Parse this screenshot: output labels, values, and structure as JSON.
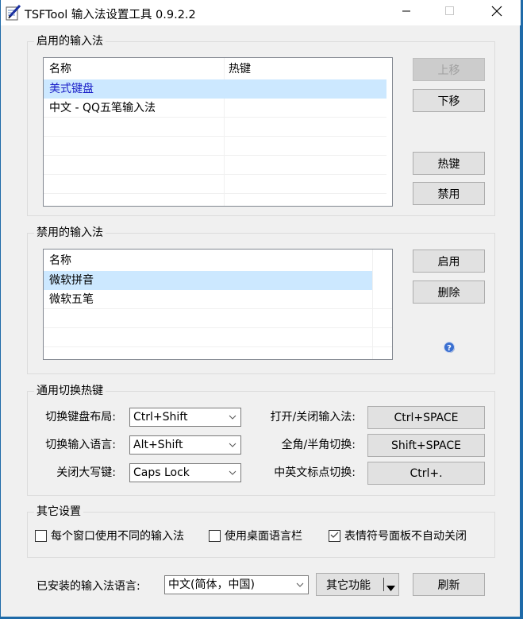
{
  "window": {
    "title": "TSFTool 输入法设置工具 0.9.2.2",
    "controls": {
      "minimize": "minimize-icon",
      "maximize": "maximize-icon",
      "close": "close-icon"
    }
  },
  "enabled_group": {
    "title": "启用的输入法",
    "columns": [
      "名称",
      "热键"
    ],
    "rows": [
      {
        "name": "美式键盘",
        "hotkey": "",
        "selected": true
      },
      {
        "name": "中文 - QQ五笔输入法",
        "hotkey": "",
        "selected": false
      }
    ],
    "buttons": {
      "move_up": "上移",
      "move_down": "下移",
      "hotkey": "热键",
      "disable": "禁用"
    }
  },
  "disabled_group": {
    "title": "禁用的输入法",
    "columns": [
      "名称"
    ],
    "rows": [
      {
        "name": "微软拼音",
        "selected": true
      },
      {
        "name": "微软五笔",
        "selected": false
      }
    ],
    "buttons": {
      "enable": "启用",
      "delete": "删除"
    },
    "help_icon": "help-icon"
  },
  "hotkeys_group": {
    "title": "通用切换热键",
    "switch_layout_label": "切换键盘布局:",
    "switch_layout_value": "Ctrl+Shift",
    "switch_language_label": "切换输入语言:",
    "switch_language_value": "Alt+Shift",
    "caps_off_label": "关闭大写键:",
    "caps_off_value": "Caps Lock",
    "toggle_ime_label": "打开/关闭输入法:",
    "toggle_ime_value": "Ctrl+SPACE",
    "full_half_label": "全角/半角切换:",
    "full_half_value": "Shift+SPACE",
    "punct_label": "中英文标点切换:",
    "punct_value": "Ctrl+."
  },
  "other_group": {
    "title": "其它设置",
    "options": [
      {
        "label": "每个窗口使用不同的输入法",
        "checked": false
      },
      {
        "label": "使用桌面语言栏",
        "checked": false
      },
      {
        "label": "表情符号面板不自动关闭",
        "checked": true
      }
    ]
  },
  "footer": {
    "installed_lang_label": "已安装的输入法语言:",
    "installed_lang_value": "中文(简体，中国)",
    "other_functions": "其它功能",
    "refresh": "刷新"
  }
}
